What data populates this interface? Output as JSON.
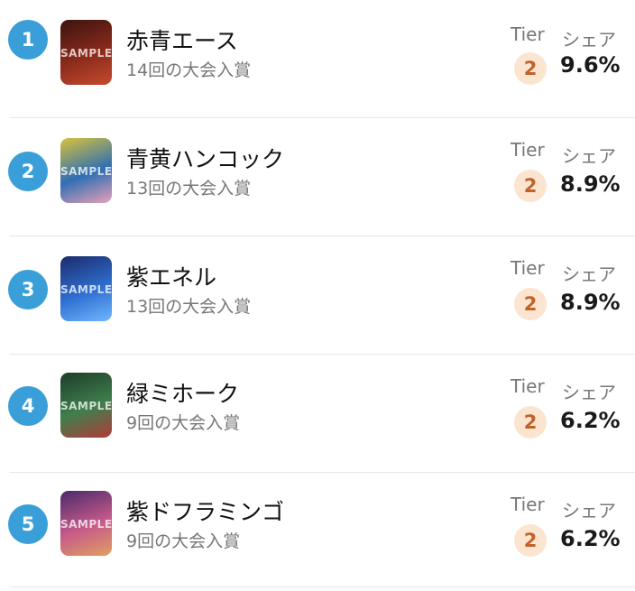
{
  "labels": {
    "tier": "Tier",
    "share": "シェア"
  },
  "entries": [
    {
      "rank": "1",
      "name": "赤青エース",
      "sub": "14回の大会入賞",
      "tier": "2",
      "share": "9.6%",
      "thumb_colors": [
        "#3a1410",
        "#8b2a1c",
        "#c64b2d"
      ],
      "watermark": "SAMPLE"
    },
    {
      "rank": "2",
      "name": "青黄ハンコック",
      "sub": "13回の大会入賞",
      "tier": "2",
      "share": "8.9%",
      "thumb_colors": [
        "#d9c23a",
        "#2f6fb3",
        "#e8a0b8"
      ],
      "watermark": "SAMPLE"
    },
    {
      "rank": "3",
      "name": "紫エネル",
      "sub": "13回の大会入賞",
      "tier": "2",
      "share": "8.9%",
      "thumb_colors": [
        "#1b2b6b",
        "#2f6fd0",
        "#6fb7ff"
      ],
      "watermark": "SAMPLE"
    },
    {
      "rank": "4",
      "name": "緑ミホーク",
      "sub": "9回の大会入賞",
      "tier": "2",
      "share": "6.2%",
      "thumb_colors": [
        "#1d3d2a",
        "#3f7f4c",
        "#b23a3a"
      ],
      "watermark": "SAMPLE"
    },
    {
      "rank": "5",
      "name": "紫ドフラミンゴ",
      "sub": "9回の大会入賞",
      "tier": "2",
      "share": "6.2%",
      "thumb_colors": [
        "#4a2a6b",
        "#c65a8a",
        "#e0a060"
      ],
      "watermark": "SAMPLE"
    }
  ]
}
